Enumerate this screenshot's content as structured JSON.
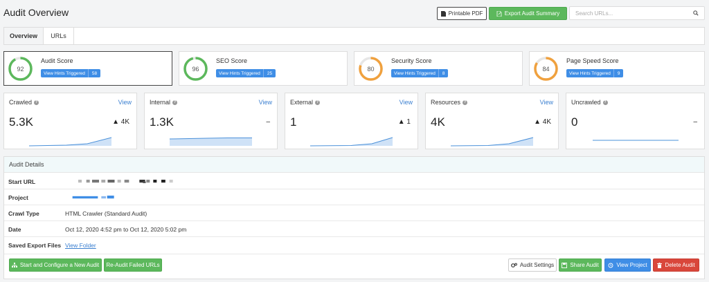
{
  "page": {
    "title": "Audit Overview"
  },
  "header": {
    "printable_pdf": "Printable PDF",
    "export_summary": "Export Audit Summary",
    "search_placeholder": "Search URLs..."
  },
  "tabs": [
    {
      "label": "Overview",
      "active": true
    },
    {
      "label": "URLs",
      "active": false
    }
  ],
  "score_cards": [
    {
      "label": "Audit Score",
      "value": 92,
      "hints_label": "View Hints Triggered",
      "hints_count": "58",
      "color": "#5cb85c"
    },
    {
      "label": "SEO Score",
      "value": 96,
      "hints_label": "View Hints Triggered",
      "hints_count": "25",
      "color": "#5cb85c"
    },
    {
      "label": "Security Score",
      "value": 80,
      "hints_label": "View Hints Triggered",
      "hints_count": "8",
      "color": "#f0a13e"
    },
    {
      "label": "Page Speed Score",
      "value": 84,
      "hints_label": "View Hints Triggered",
      "hints_count": "9",
      "color": "#f0a13e"
    }
  ],
  "stat_cards": [
    {
      "label": "Crawled",
      "view": "View",
      "value": "5.3K",
      "delta": "▲ 4K"
    },
    {
      "label": "Internal",
      "view": "View",
      "value": "1.3K",
      "delta": "–"
    },
    {
      "label": "External",
      "view": "View",
      "value": "1",
      "delta": "▲ 1"
    },
    {
      "label": "Resources",
      "view": "View",
      "value": "4K",
      "delta": "▲ 4K"
    },
    {
      "label": "Uncrawled",
      "view": "",
      "value": "0",
      "delta": "–"
    }
  ],
  "audit_details": {
    "title": "Audit Details",
    "rows": [
      {
        "label": "Start URL",
        "value": ""
      },
      {
        "label": "Project",
        "value": ""
      },
      {
        "label": "Crawl Type",
        "value": "HTML Crawler (Standard Audit)"
      },
      {
        "label": "Date",
        "value": "Oct 12, 2020 4:52 pm to Oct 12, 2020 5:02 pm"
      },
      {
        "label": "Saved Export Files",
        "value": "View Folder"
      }
    ]
  },
  "actions": {
    "start_new": "Start and Configure a New Audit",
    "reaudit_failed": "Re-Audit Failed URLs",
    "audit_settings": "Audit Settings",
    "share_audit": "Share Audit",
    "view_project": "View Project",
    "delete_audit": "Delete Audit"
  },
  "colors": {
    "green": "#5cb85c",
    "orange": "#f0a13e",
    "blue": "#3f8ee6",
    "red": "#d9473b",
    "link": "#3a7fd0"
  }
}
